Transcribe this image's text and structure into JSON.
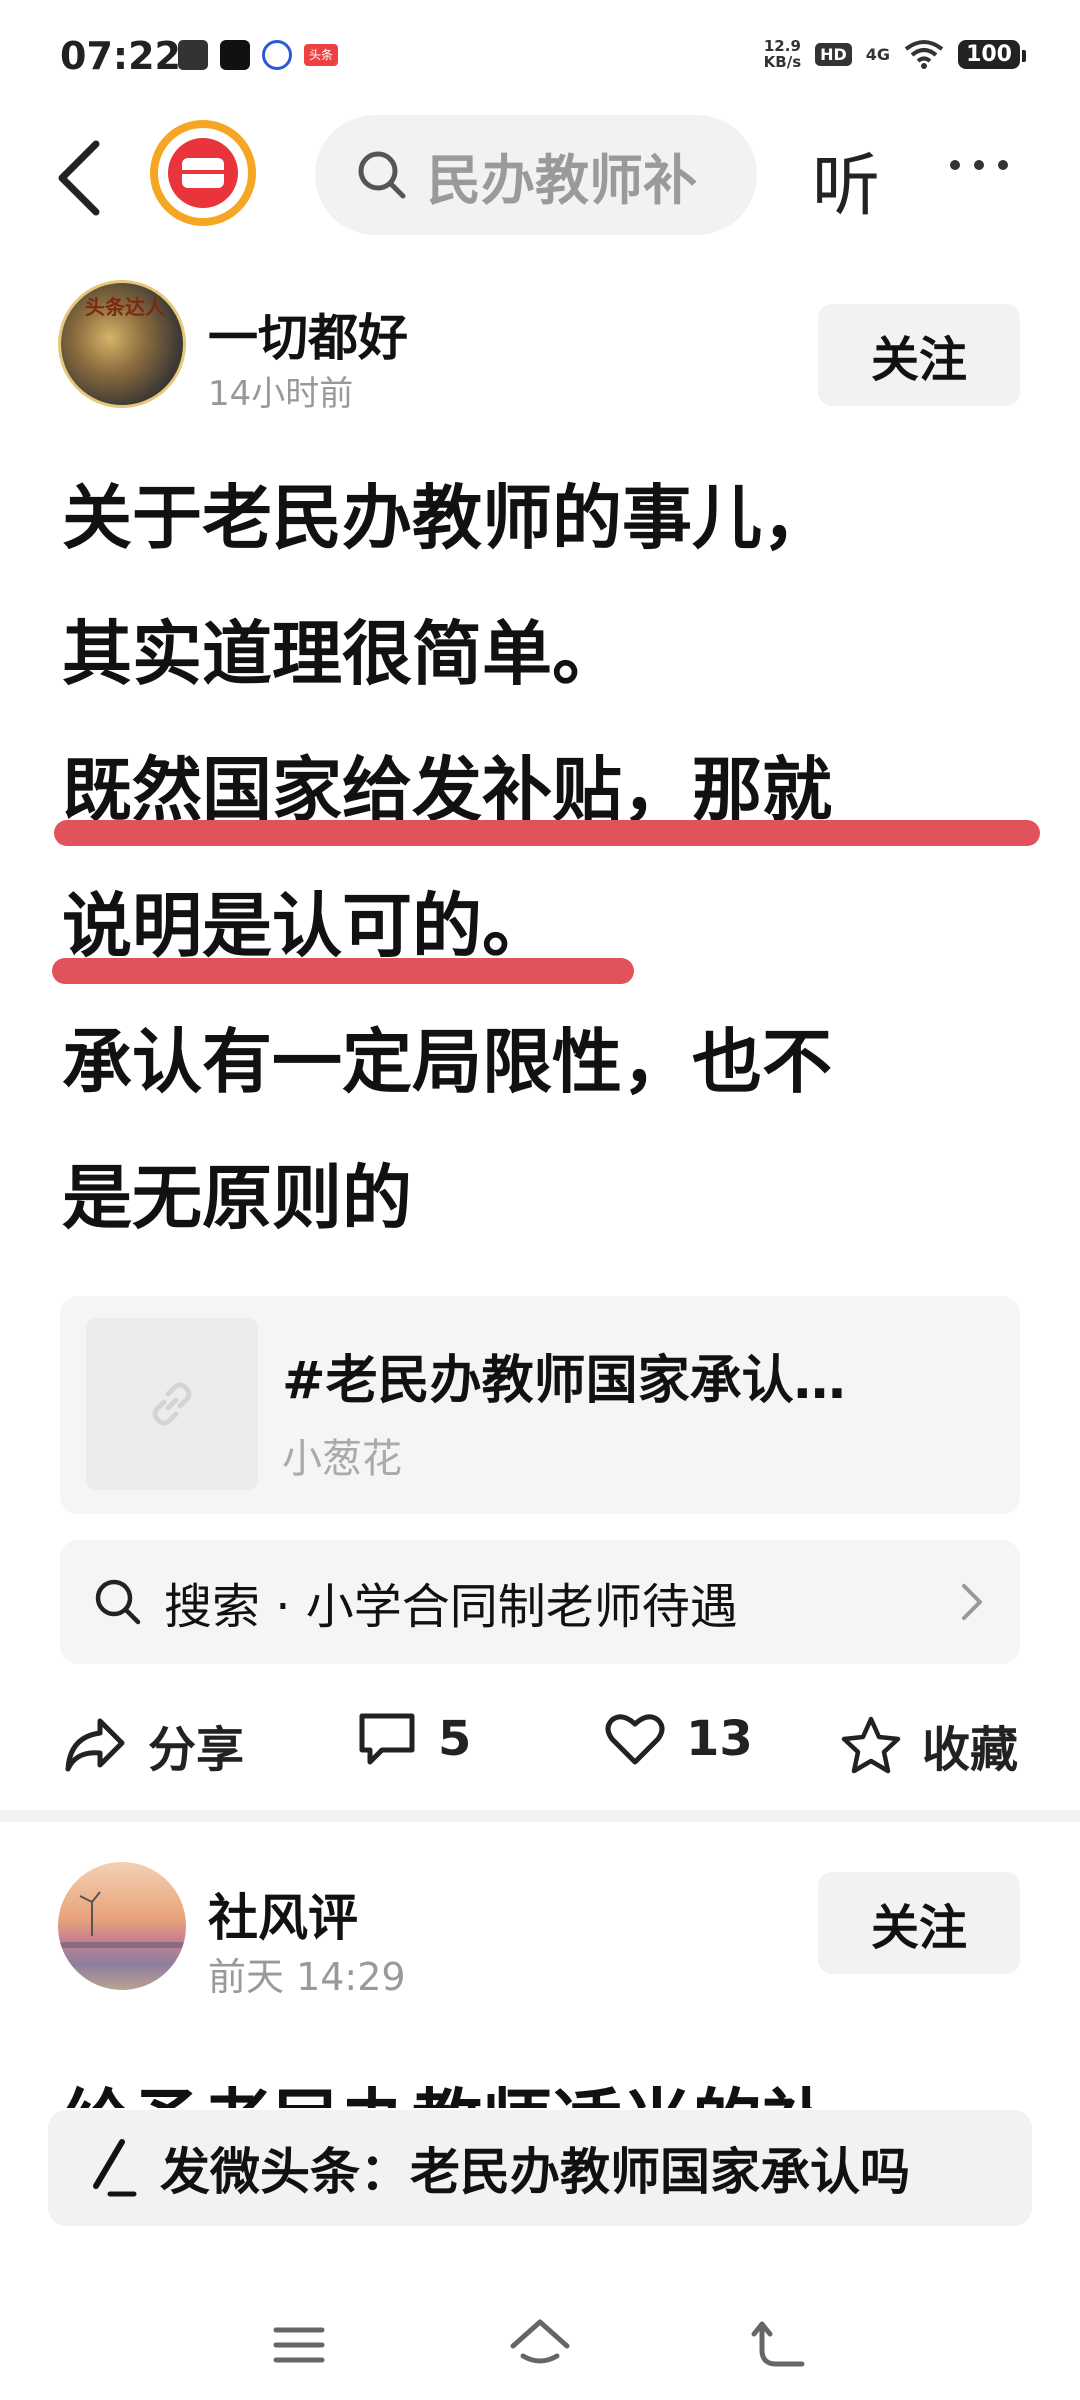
{
  "status_bar": {
    "time": "07:22",
    "net_speed_value": "12.9",
    "net_speed_unit": "KB/s",
    "hd": "HD",
    "network": "4G",
    "battery": "100",
    "toutiao_badge": "头条"
  },
  "header": {
    "search_query": "民办教师补",
    "listen_label": "听"
  },
  "post": {
    "author": "一切都好",
    "avatar_badge": "头条达人",
    "time": "14小时前",
    "follow_label": "关注",
    "lines": [
      "关于老民办教师的事儿，",
      "其实道理很简单。",
      "既然国家给发补贴，那就",
      "说明是认可的。",
      "承认有一定局限性，也不",
      "是无原则的"
    ],
    "link_card": {
      "title": "#老民办教师国家承认…",
      "source": "小葱花"
    },
    "search_suggestion": "搜索 · 小学合同制老师待遇",
    "actions": {
      "share": "分享",
      "comments": "5",
      "likes": "13",
      "favorite": "收藏"
    }
  },
  "post2": {
    "author": "社风评",
    "time": "前天  14:29",
    "follow_label": "关注",
    "peek_text": "给予老民办教师适当的补"
  },
  "compose_bar": {
    "text": "发微头条：老民办教师国家承认吗"
  },
  "colors": {
    "highlight": "#e2525a",
    "logo_ring": "#f5a623",
    "logo_red": "#e9343b"
  }
}
